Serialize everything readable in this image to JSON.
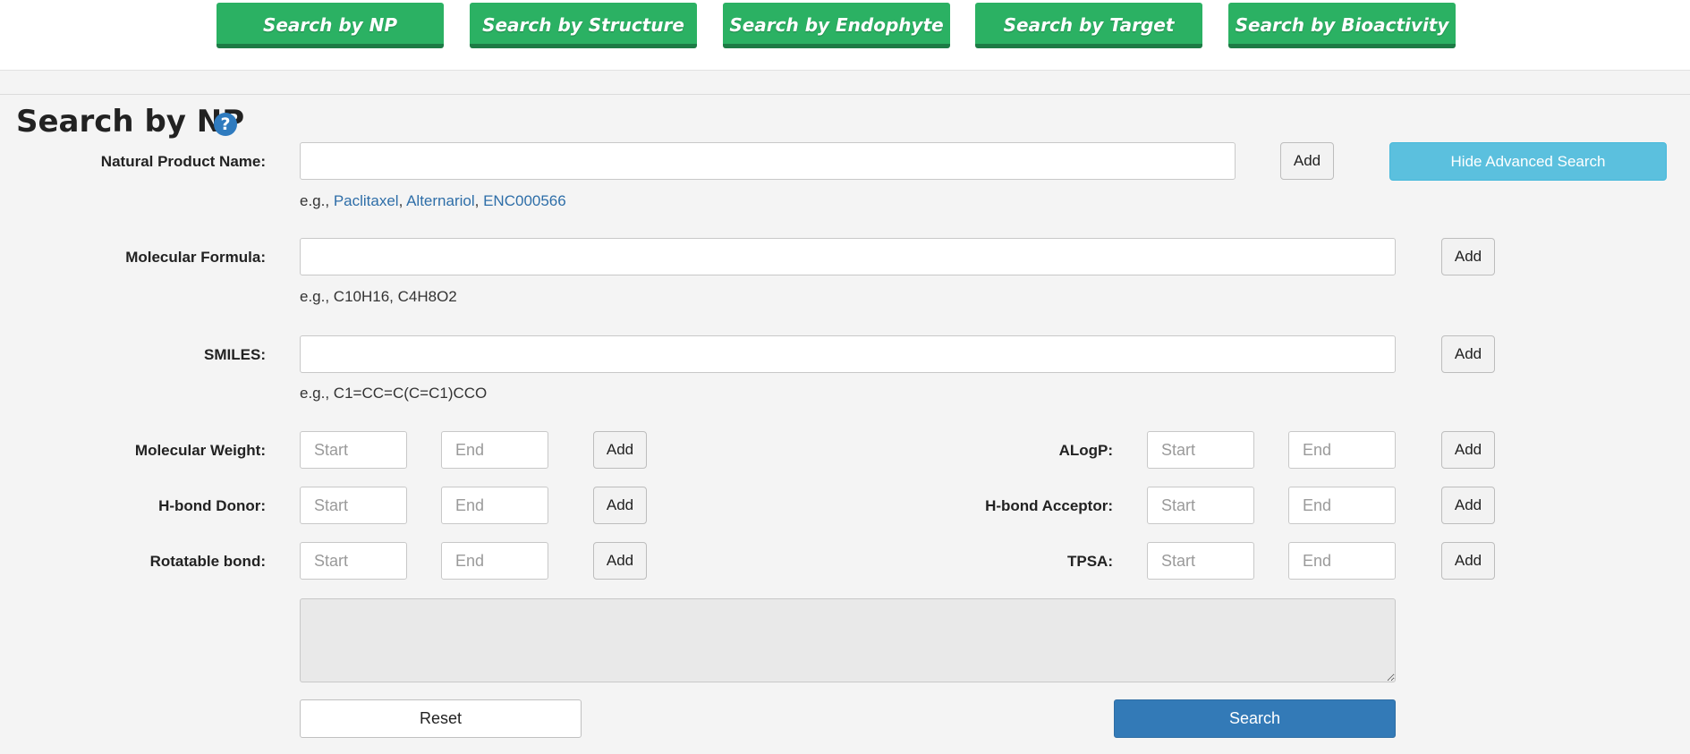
{
  "top_tabs": [
    {
      "label": "Search by NP"
    },
    {
      "label": "Search by Structure"
    },
    {
      "label": "Search by Endophyte"
    },
    {
      "label": "Search by Target"
    },
    {
      "label": "Search by Bioactivity"
    }
  ],
  "page": {
    "title": "Search by NP",
    "help_glyph": "?"
  },
  "advanced_toggle_label": "Hide Advanced Search",
  "add_label": "Add",
  "fields": {
    "np_name": {
      "label": "Natural Product Name:",
      "value": "",
      "hint_prefix": "e.g., ",
      "examples": [
        "Paclitaxel",
        "Alternariol",
        "ENC000566"
      ],
      "separator": ", "
    },
    "formula": {
      "label": "Molecular Formula:",
      "value": "",
      "hint": "e.g., C10H16, C4H8O2"
    },
    "smiles": {
      "label": "SMILES:",
      "value": "",
      "hint": "e.g., C1=CC=C(C=C1)CCO"
    }
  },
  "range_fields": {
    "start_placeholder": "Start",
    "end_placeholder": "End",
    "molecular_weight": {
      "label": "Molecular Weight:"
    },
    "alogp": {
      "label": "ALogP:"
    },
    "hbond_donor": {
      "label": "H-bond Donor:"
    },
    "hbond_acceptor": {
      "label": "H-bond Acceptor:"
    },
    "rotatable_bond": {
      "label": "Rotatable bond:"
    },
    "tpsa": {
      "label": "TPSA:"
    }
  },
  "query_box_value": "",
  "buttons": {
    "reset": "Reset",
    "search": "Search"
  },
  "colors": {
    "tab_green": "#2bb163",
    "advanced_blue": "#5bc0de",
    "search_blue": "#337ab7",
    "link_blue": "#2e6ea8"
  }
}
